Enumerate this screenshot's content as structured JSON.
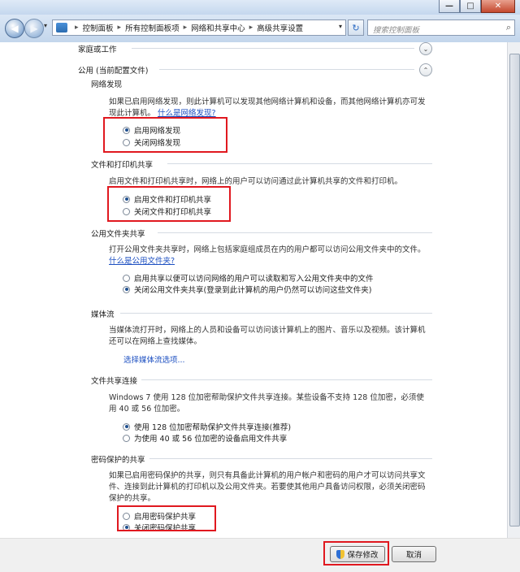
{
  "window": {
    "minimize_glyph": "—",
    "maximize_glyph": "□",
    "close_glyph": "✕"
  },
  "nav": {
    "back_glyph": "◀",
    "forward_glyph": "▶",
    "breadcrumb": [
      "控制面板",
      "所有控制面板项",
      "网络和共享中心",
      "高级共享设置"
    ],
    "breadcrumb_separator": "▸",
    "search_placeholder": "搜索控制面板"
  },
  "profiles": {
    "home_work": {
      "label": "家庭或工作"
    },
    "public": {
      "label": "公用 (当前配置文件)"
    }
  },
  "sections": {
    "network_discovery": {
      "title": "网络发现",
      "desc": "如果已启用网络发现，则此计算机可以发现其他网络计算机和设备，而其他网络计算机亦可发现此计算机。",
      "link": "什么是网络发现?",
      "options": [
        {
          "label": "启用网络发现",
          "selected": true
        },
        {
          "label": "关闭网络发现",
          "selected": false
        }
      ]
    },
    "file_printer_sharing": {
      "title": "文件和打印机共享",
      "desc": "启用文件和打印机共享时，网络上的用户可以访问通过此计算机共享的文件和打印机。",
      "options": [
        {
          "label": "启用文件和打印机共享",
          "selected": true
        },
        {
          "label": "关闭文件和打印机共享",
          "selected": false
        }
      ]
    },
    "public_folder_sharing": {
      "title": "公用文件夹共享",
      "desc": "打开公用文件夹共享时，网络上包括家庭组成员在内的用户都可以访问公用文件夹中的文件。",
      "link": "什么是公用文件夹?",
      "options": [
        {
          "label": "启用共享以便可以访问网络的用户可以读取和写入公用文件夹中的文件",
          "selected": false
        },
        {
          "label": "关闭公用文件夹共享(登录到此计算机的用户仍然可以访问这些文件夹)",
          "selected": true
        }
      ]
    },
    "media_streaming": {
      "title": "媒体流",
      "desc": "当媒体流打开时，网络上的人员和设备可以访问该计算机上的图片、音乐以及视频。该计算机还可以在网络上查找媒体。",
      "link": "选择媒体流选项..."
    },
    "file_sharing_connections": {
      "title": "文件共享连接",
      "desc": "Windows 7 使用 128 位加密帮助保护文件共享连接。某些设备不支持 128 位加密，必须使用 40 或 56 位加密。",
      "options": [
        {
          "label": "使用 128 位加密帮助保护文件共享连接(推荐)",
          "selected": true
        },
        {
          "label": "为使用 40 或 56 位加密的设备启用文件共享",
          "selected": false
        }
      ]
    },
    "password_sharing": {
      "title": "密码保护的共享",
      "desc": "如果已启用密码保护的共享，则只有具备此计算机的用户帐户和密码的用户才可以访问共享文件、连接到此计算机的打印机以及公用文件夹。若要使其他用户具备访问权限，必须关闭密码保护的共享。",
      "options": [
        {
          "label": "启用密码保护共享",
          "selected": false
        },
        {
          "label": "关闭密码保护共享",
          "selected": true
        }
      ]
    }
  },
  "footer": {
    "save_label": "保存修改",
    "cancel_label": "取消"
  },
  "colors": {
    "highlight_box": "#e0181f",
    "link": "#1c4fc1"
  }
}
